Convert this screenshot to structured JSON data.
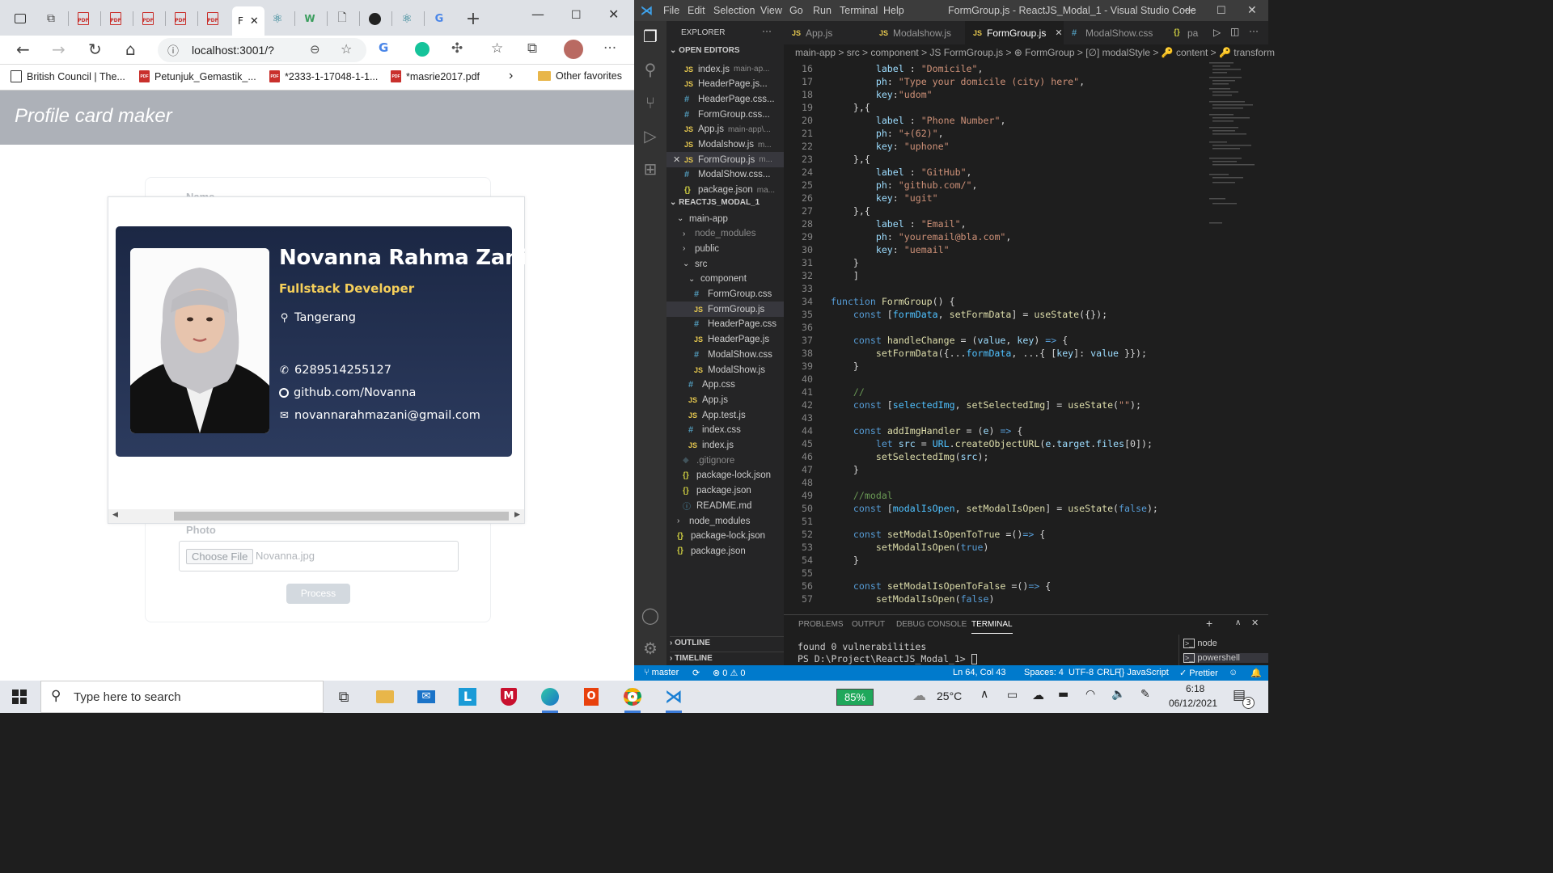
{
  "browser": {
    "active_tab_label": "F",
    "url": "localhost:3001/?",
    "bookmarks": [
      {
        "label": "British Council | The...",
        "type": "site"
      },
      {
        "label": "Petunjuk_Gemastik_...",
        "type": "pdf"
      },
      {
        "label": "*2333-1-17048-1-1...",
        "type": "pdf"
      },
      {
        "label": "*masrie2017.pdf",
        "type": "pdf"
      }
    ],
    "other_favorites": "Other favorites"
  },
  "app": {
    "header_title": "Profile card maker",
    "form": {
      "name_label": "Name",
      "photo_label": "Photo",
      "choose_file_label": "Choose File",
      "file_name": "Novanna.jpg",
      "process_label": "Process"
    },
    "profile": {
      "name": "Novanna Rahma Zani",
      "role": "Fullstack Developer",
      "domicile": "Tangerang",
      "phone": "6289514255127",
      "github": "github.com/Novanna",
      "email": "novannarahmazani@gmail.com"
    }
  },
  "vscode": {
    "menu": [
      "File",
      "Edit",
      "Selection",
      "View",
      "Go",
      "Run",
      "Terminal",
      "Help"
    ],
    "title": "FormGroup.js - ReactJS_Modal_1 - Visual Studio Code",
    "explorer_label": "EXPLORER",
    "open_editors_label": "OPEN EDITORS",
    "open_editors": [
      {
        "name": "index.js",
        "sub": "main-ap...",
        "kind": "js"
      },
      {
        "name": "HeaderPage.js...",
        "sub": "",
        "kind": "js"
      },
      {
        "name": "HeaderPage.css...",
        "sub": "",
        "kind": "css"
      },
      {
        "name": "FormGroup.css...",
        "sub": "",
        "kind": "css"
      },
      {
        "name": "App.js",
        "sub": "main-app\\...",
        "kind": "js"
      },
      {
        "name": "Modalshow.js",
        "sub": "m...",
        "kind": "js"
      },
      {
        "name": "FormGroup.js",
        "sub": "m...",
        "kind": "js"
      },
      {
        "name": "ModalShow.css...",
        "sub": "",
        "kind": "css"
      },
      {
        "name": "package.json",
        "sub": "ma...",
        "kind": "json"
      }
    ],
    "project_label": "REACTJS_MODAL_1",
    "tree": [
      {
        "name": "main-app",
        "kind": "folder-open",
        "indent": 1
      },
      {
        "name": "node_modules",
        "kind": "folder",
        "indent": 2
      },
      {
        "name": "public",
        "kind": "folder",
        "indent": 2
      },
      {
        "name": "src",
        "kind": "folder-open",
        "indent": 2
      },
      {
        "name": "component",
        "kind": "folder-open",
        "indent": 3
      },
      {
        "name": "FormGroup.css",
        "kind": "css",
        "indent": 4
      },
      {
        "name": "FormGroup.js",
        "kind": "js",
        "indent": 4
      },
      {
        "name": "HeaderPage.css",
        "kind": "css",
        "indent": 4
      },
      {
        "name": "HeaderPage.js",
        "kind": "js",
        "indent": 4
      },
      {
        "name": "ModalShow.css",
        "kind": "css",
        "indent": 4
      },
      {
        "name": "ModalShow.js",
        "kind": "js",
        "indent": 4
      },
      {
        "name": "App.css",
        "kind": "css",
        "indent": 3
      },
      {
        "name": "App.js",
        "kind": "js",
        "indent": 3
      },
      {
        "name": "App.test.js",
        "kind": "js",
        "indent": 3
      },
      {
        "name": "index.css",
        "kind": "css",
        "indent": 3
      },
      {
        "name": "index.js",
        "kind": "js",
        "indent": 3
      },
      {
        "name": ".gitignore",
        "kind": "git",
        "indent": 2
      },
      {
        "name": "package-lock.json",
        "kind": "json",
        "indent": 2
      },
      {
        "name": "package.json",
        "kind": "json",
        "indent": 2
      },
      {
        "name": "README.md",
        "kind": "md",
        "indent": 2
      },
      {
        "name": "node_modules",
        "kind": "folder",
        "indent": 1
      },
      {
        "name": "package-lock.json",
        "kind": "json",
        "indent": 1
      },
      {
        "name": "package.json",
        "kind": "json",
        "indent": 1
      }
    ],
    "outline_label": "OUTLINE",
    "timeline_label": "TIMELINE",
    "tabs": [
      {
        "name": "App.js",
        "kind": "js"
      },
      {
        "name": "Modalshow.js",
        "kind": "js"
      },
      {
        "name": "FormGroup.js",
        "kind": "js",
        "active": true
      },
      {
        "name": "ModalShow.css",
        "kind": "css"
      },
      {
        "name": "pa",
        "kind": "json"
      }
    ],
    "breadcrumbs": "main-app > src > component > JS FormGroup.js > ⊕ FormGroup > [∅] modalStyle > 🔑 content > 🔑 transform",
    "code_start_line": 16,
    "panel_tabs": [
      "PROBLEMS",
      "OUTPUT",
      "DEBUG CONSOLE",
      "TERMINAL"
    ],
    "terminal_lines": [
      "found 0 vulnerabilities",
      "PS D:\\Project\\ReactJS_Modal_1> "
    ],
    "terminal_sessions": [
      "node",
      "powershell"
    ],
    "status": {
      "branch": "master",
      "problems": "⊗ 0 ⚠ 0",
      "position": "Ln 64, Col 43",
      "spaces": "Spaces: 4",
      "encoding": "UTF-8",
      "eol": "CRLF",
      "language": "{} JavaScript",
      "formatter": "✓ Prettier"
    }
  },
  "taskbar": {
    "search_placeholder": "Type here to search",
    "battery": "85%",
    "weather": "25°C",
    "time": "6:18",
    "date": "06/12/2021",
    "notifications": "3"
  }
}
